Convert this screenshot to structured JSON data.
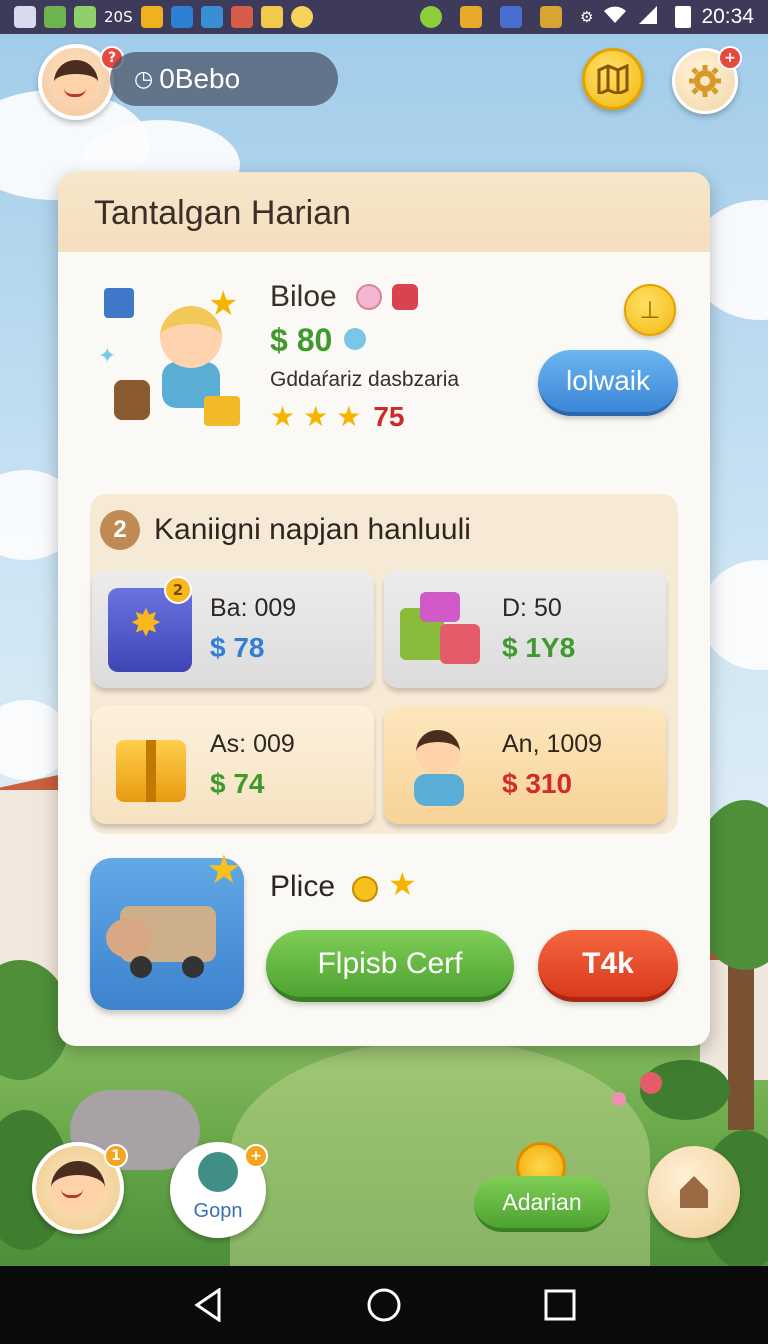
{
  "status_bar": {
    "left_text": "20S",
    "time": "20:34"
  },
  "player": {
    "name": "0Bebo",
    "avatar_badge": "?",
    "settings_badge": "+"
  },
  "panel": {
    "title": "Tantalgan Harian",
    "featured": {
      "name": "Biloe",
      "price": "$ 80",
      "description": "Gddaŕariz dasbzaria",
      "stars": 3,
      "score": "75",
      "action_label": "lolwaik"
    },
    "section": {
      "number": "2",
      "title": "Kaniigni napjan hanluuli",
      "cards": [
        {
          "line1": "Ba: 009",
          "line2": "$ 78",
          "price_color": "#2f7fd4",
          "style": "grey",
          "icon": "mystery-box-icon",
          "badge": "2"
        },
        {
          "line1": "D: 50",
          "line2": "$ 1Y8",
          "price_color": "#3e9a2c",
          "style": "grey",
          "icon": "gift-bundle-icon"
        },
        {
          "line1": "As: 009",
          "line2": "$ 74",
          "price_color": "#3e9a2c",
          "style": "cream",
          "icon": "gold-gift-icon"
        },
        {
          "line1": "An, 1009",
          "line2": "$ 310",
          "price_color": "#d22b2b",
          "style": "orange",
          "icon": "boy-character-icon"
        }
      ]
    },
    "plice": {
      "name": "Plice",
      "primary_label": "Flpisb Cerf",
      "secondary_label": "T4k"
    }
  },
  "bottom_hud": {
    "avatar_badge": "1",
    "gopn_label": "Gopn",
    "gopn_badge": "+",
    "adarian_label": "Adarian"
  },
  "colors": {
    "price_green": "#3e9a2c",
    "score_red": "#cc2a2a",
    "blue_button": "#3b86d6",
    "green_button": "#4ea231",
    "red_button": "#d93a1d"
  }
}
